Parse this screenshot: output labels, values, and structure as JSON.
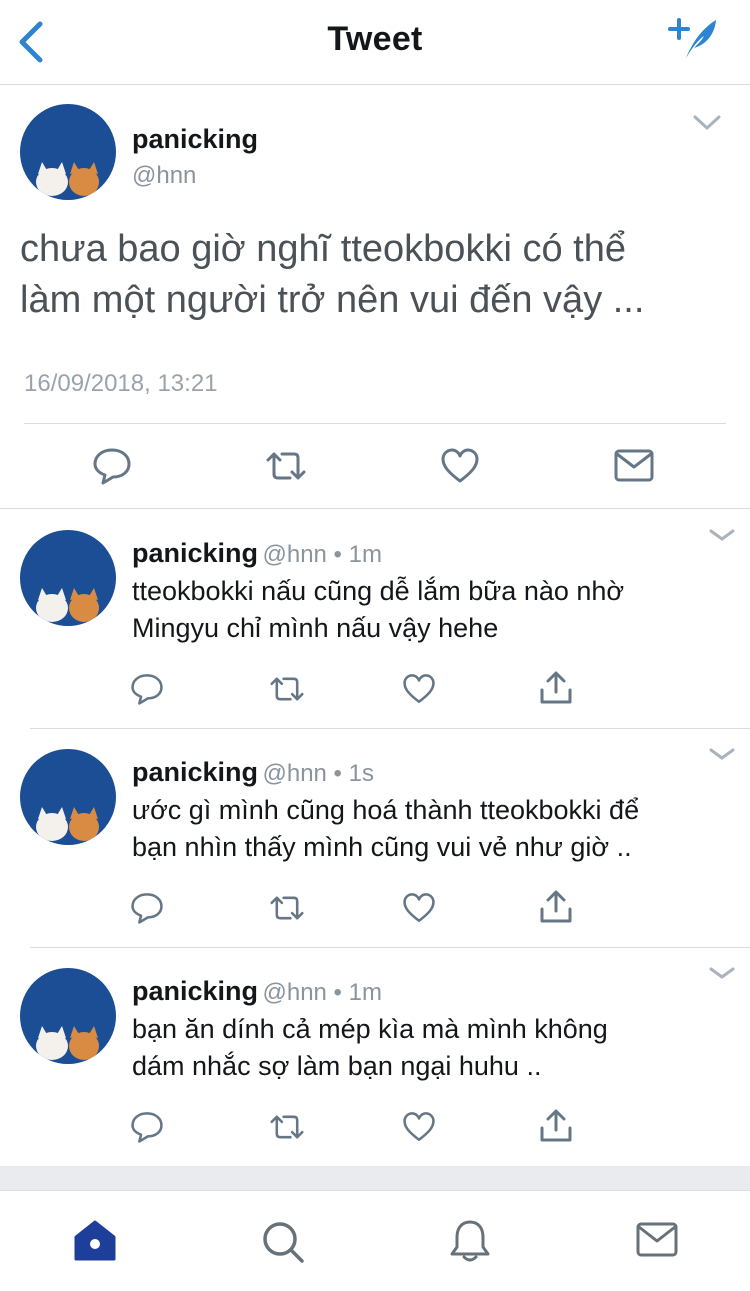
{
  "header": {
    "title": "Tweet",
    "back_icon": "chevron-left-icon",
    "compose_icon": "compose-tweet-icon",
    "accent": "#2f84d2"
  },
  "main_tweet": {
    "name": "panicking",
    "handle": "@hnn",
    "text_line1": "chưa bao giờ nghĩ tteokbokki có thể",
    "text_line2": "làm một người trở nên vui đến vậy ...",
    "timestamp": "16/09/2018, 13:21",
    "actions": [
      "reply-icon",
      "retweet-icon",
      "like-icon",
      "message-icon"
    ]
  },
  "replies": [
    {
      "name": "panicking",
      "meta": "@hnn • 1m",
      "line1": "tteokbokki nấu cũng dễ lắm bữa nào nhờ",
      "line2": "Mingyu chỉ mình nấu vậy hehe"
    },
    {
      "name": "panicking",
      "meta": "@hnn • 1s",
      "line1": "ước gì mình cũng hoá thành tteokbokki để",
      "line2": "bạn nhìn thấy mình cũng vui vẻ như giờ .."
    },
    {
      "name": "panicking",
      "meta": "@hnn • 1m",
      "line1": "bạn ăn dính cả mép kìa mà mình không",
      "line2": "dám nhắc sợ làm bạn ngại huhu .."
    }
  ],
  "bottom_nav": {
    "items": [
      "home-icon",
      "search-icon",
      "notifications-icon",
      "messages-icon"
    ],
    "active_color": "#1d3f9a",
    "inactive_color": "#67717a"
  }
}
